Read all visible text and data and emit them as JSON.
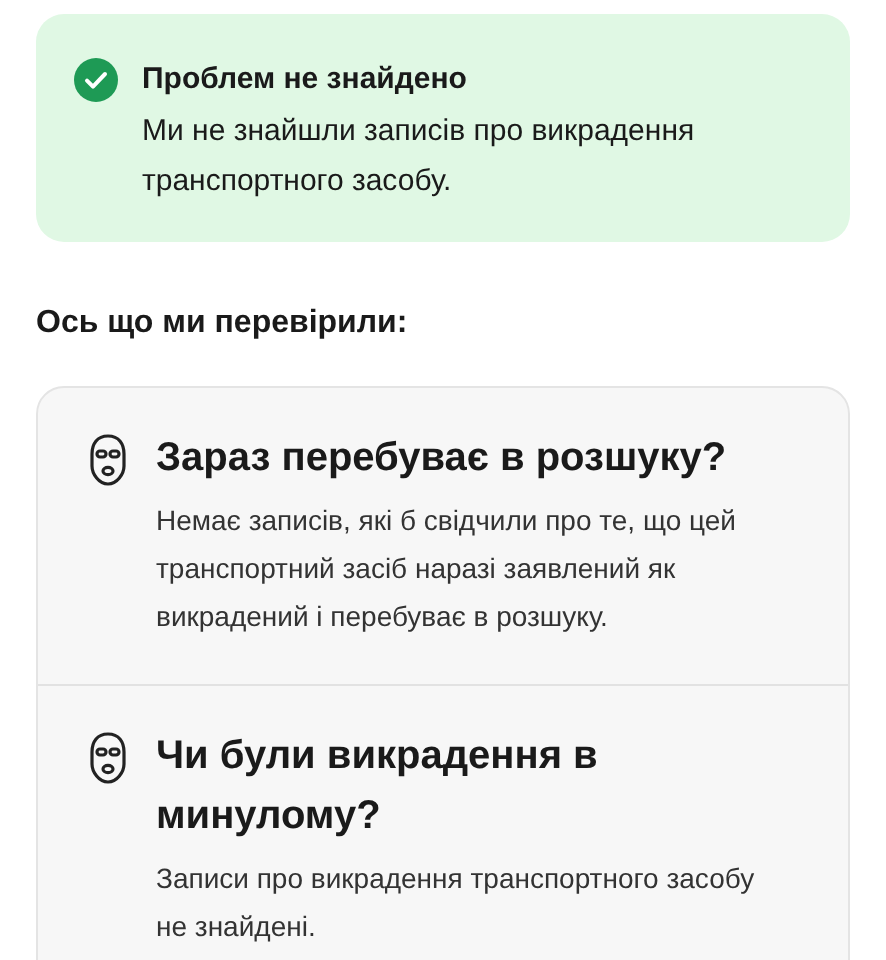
{
  "alert": {
    "title": "Проблем не знайдено",
    "message": "Ми не знайшли записів про викрадення транспортного засобу."
  },
  "section_heading": "Ось що ми перевірили:",
  "checks": [
    {
      "title": "Зараз перебуває в розшуку?",
      "description": "Немає записів, які б свідчили про те, що цей транспортний засіб наразі заявлений як викрадений і перебуває в розшуку."
    },
    {
      "title": "Чи були викрадення в минулому?",
      "description": "Записи про викрадення транспортного засобу не знайдені."
    }
  ]
}
